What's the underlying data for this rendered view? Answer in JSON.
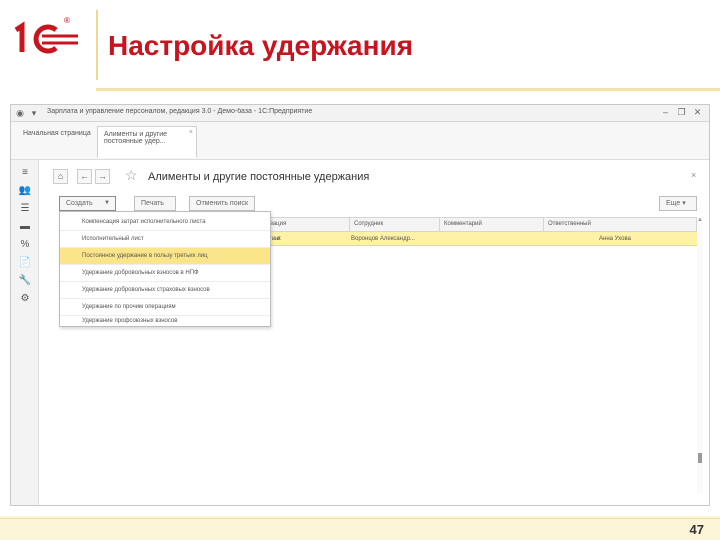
{
  "slide": {
    "title": "Настройка удержания",
    "page_number": "47",
    "brand_color": "#c8141e"
  },
  "window": {
    "titlebar_text": "Зарплата и управление персоналом, редакция 3.0 - Демо-база - 1С:Предприятие",
    "home_tab": "Начальная страница",
    "active_tab": "Алименты и другие постоянные удер...",
    "active_tab_close": "×",
    "titlebar_icons": [
      "minimize-icon",
      "restore-icon",
      "close-icon"
    ]
  },
  "form": {
    "title": "Алименты и другие постоянные удержания",
    "close": "×",
    "buttons": {
      "create": "Создать",
      "print": "Печать",
      "cancel": "Отменить поиск",
      "more": "Еще"
    }
  },
  "table": {
    "columns": [
      "Организация",
      "Сотрудник",
      "Комментарий",
      "Ответственный"
    ],
    "row": {
      "c0": "...к",
      "organization": "Консалтинг",
      "employee": "Воронцов Александр...",
      "responsible": "Анна Ухова"
    }
  },
  "dropdown": {
    "items": [
      "Компенсация затрат исполнительного листа",
      "Исполнительный лист",
      "Постоянное удержание в пользу третьих лиц",
      "Удержание добровольных взносов в НПФ",
      "Удержание добровольных страховых взносов",
      "Удержание по прочим операциям",
      "Удержание профсоюзных взносов"
    ],
    "selected_index": 2,
    "highlight_color": "#fbe58a"
  }
}
